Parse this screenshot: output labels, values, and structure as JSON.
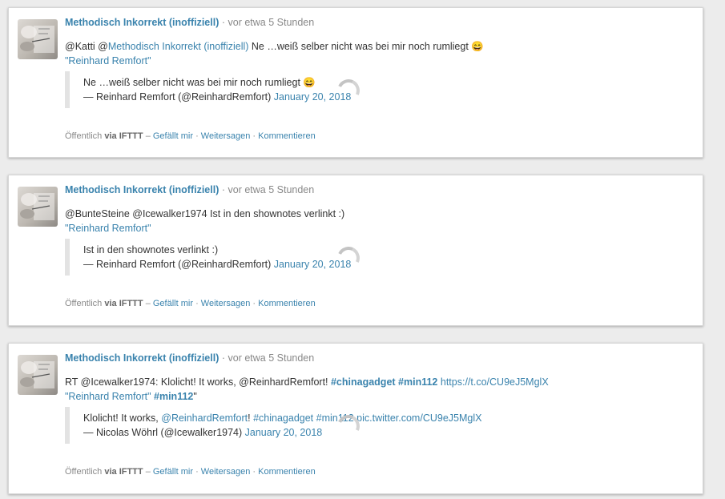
{
  "posts": [
    {
      "author": "Methodisch Inkorrekt (inoffiziell)",
      "time": "· vor etwa 5 Stunden",
      "body_line1": [
        {
          "t": "text",
          "v": "@Katti @"
        },
        {
          "t": "link",
          "v": "Methodisch Inkorrekt (inoffiziell)"
        },
        {
          "t": "text",
          "v": " Ne …weiß selber nicht was bei mir noch rumliegt 😄"
        }
      ],
      "body_line2": [
        {
          "t": "link",
          "v": "\"Reinhard Remfort\""
        }
      ],
      "quote_line1": [
        {
          "t": "text",
          "v": "Ne …weiß selber nicht was bei mir noch rumliegt 😄"
        }
      ],
      "quote_line2": [
        {
          "t": "text",
          "v": "— Reinhard Remfort (@ReinhardRemfort) "
        },
        {
          "t": "link",
          "v": "January 20, 2018"
        }
      ],
      "visibility": "Öffentlich",
      "via": "via IFTTT",
      "dash": "–",
      "like": "Gefällt mir",
      "share": "Weitersagen",
      "comment": "Kommentieren",
      "sep": "·"
    },
    {
      "author": "Methodisch Inkorrekt (inoffiziell)",
      "time": "· vor etwa 5 Stunden",
      "body_line1": [
        {
          "t": "text",
          "v": "@BunteSteine @Icewalker1974 Ist in den shownotes verlinkt :)"
        }
      ],
      "body_line2": [
        {
          "t": "link",
          "v": "\"Reinhard Remfort\""
        }
      ],
      "quote_line1": [
        {
          "t": "text",
          "v": "Ist in den shownotes verlinkt :)"
        }
      ],
      "quote_line2": [
        {
          "t": "text",
          "v": "— Reinhard Remfort (@ReinhardRemfort) "
        },
        {
          "t": "link",
          "v": "January 20, 2018"
        }
      ],
      "visibility": "Öffentlich",
      "via": "via IFTTT",
      "dash": "–",
      "like": "Gefällt mir",
      "share": "Weitersagen",
      "comment": "Kommentieren",
      "sep": "·"
    },
    {
      "author": "Methodisch Inkorrekt (inoffiziell)",
      "time": "· vor etwa 5 Stunden",
      "body_line1": [
        {
          "t": "text",
          "v": "RT @Icewalker1974: Klolicht! It works, @ReinhardRemfort! "
        },
        {
          "t": "tag",
          "v": "#chinagadget"
        },
        {
          "t": "text",
          "v": " "
        },
        {
          "t": "tag",
          "v": "#min112"
        },
        {
          "t": "text",
          "v": " "
        },
        {
          "t": "link",
          "v": "https://t.co/CU9eJ5MglX"
        }
      ],
      "body_line2": [
        {
          "t": "link",
          "v": "\"Reinhard Remfort\""
        },
        {
          "t": "text",
          "v": " "
        },
        {
          "t": "tag",
          "v": "#min112"
        },
        {
          "t": "text",
          "v": "\""
        }
      ],
      "quote_line1": [
        {
          "t": "text",
          "v": "Klolicht! It works, "
        },
        {
          "t": "link",
          "v": "@ReinhardRemfort"
        },
        {
          "t": "text",
          "v": "! "
        },
        {
          "t": "link",
          "v": "#chinagadget"
        },
        {
          "t": "text",
          "v": " "
        },
        {
          "t": "link",
          "v": "#min112"
        },
        {
          "t": "text",
          "v": " "
        },
        {
          "t": "link",
          "v": "pic.twitter.com/CU9eJ5MglX"
        }
      ],
      "quote_line2": [
        {
          "t": "text",
          "v": "— Nicolas Wöhrl (@Icewalker1974) "
        },
        {
          "t": "link",
          "v": "January 20, 2018"
        }
      ],
      "visibility": "Öffentlich",
      "via": "via IFTTT",
      "dash": "–",
      "like": "Gefällt mir",
      "share": "Weitersagen",
      "comment": "Kommentieren",
      "sep": "·"
    }
  ],
  "colors": {
    "link": "#3a83ad",
    "muted": "#888888",
    "background": "#ececec"
  }
}
